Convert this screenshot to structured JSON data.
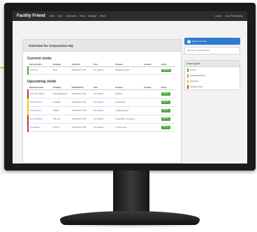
{
  "app": {
    "brand": "Facility Friend",
    "nav_items": [
      "Visits",
      "Tools",
      "Companies",
      "Hosts",
      "Manager",
      "Reset"
    ],
    "nav_right": [
      "Logout",
      "Anne.Francis@hq"
    ]
  },
  "page": {
    "title": "Overview for Corporation HQ"
  },
  "current_visits": {
    "heading": "Current visits",
    "columns": [
      "Current visitor",
      "Company",
      "Arrived at",
      "Host",
      "Purpose",
      "Location",
      "Action"
    ],
    "rows": [
      {
        "visitor": "John Doe",
        "company": "Acme",
        "arrived": "2012-06-19 17:38",
        "host": "Tom Watson",
        "purpose": "Marketing review",
        "location": "",
        "action": "Sign out",
        "status_color": "#4caa3f"
      }
    ]
  },
  "upcoming_visits": {
    "heading": "Upcoming visits",
    "columns": [
      "Expected visitor",
      "Company",
      "Scheduled for",
      "Host",
      "Purpose",
      "Location",
      "Action"
    ],
    "rows": [
      {
        "visitor": "Peter Mc Cabbles",
        "company": "Tree Management",
        "scheduled": "2012-06-19 17:58",
        "host": "Tom Watson",
        "purpose": "Meeting",
        "location": "",
        "action": "Sign in",
        "status_color": "#d6322a"
      },
      {
        "visitor": "Richard Turner",
        "company": "GOLDEN",
        "scheduled": "2012-06-19 17:58",
        "host": "Tom Watson",
        "purpose": "Presentation",
        "location": "",
        "action": "Sign in",
        "status_color": "#f0c419"
      },
      {
        "visitor": "Linnea Martin",
        "company": "SVEEC",
        "scheduled": "2012-06-19 17:58",
        "host": "Tom Watson",
        "purpose": "Logistics project",
        "location": "",
        "action": "Sign in",
        "status_color": "#f0c419"
      },
      {
        "visitor": "Tim Van Ruben",
        "company": "ATAL Ltd",
        "scheduled": "2012-06-19 17:58",
        "host": "Tom Watson",
        "purpose": "Presentation of services",
        "location": "",
        "action": "Sign in",
        "status_color": "#d6322a"
      },
      {
        "visitor": "Tom Massie",
        "company": "PLAN IT",
        "scheduled": "2012-06-19 17:58",
        "host": "Tom Watson",
        "purpose": "IT service test",
        "location": "",
        "action": "Sign in",
        "status_color": "#d6322a"
      }
    ]
  },
  "sidebar": {
    "new_visit_label": "Add a new visit",
    "new_visit_icon": "plus-circle-icon",
    "note": "Add visit by scanning visitor",
    "legend": {
      "title": "Color legend",
      "items": [
        {
          "label": "Current",
          "color": "#4caa3f"
        },
        {
          "label": "Overdue departure",
          "color": "#f08a24"
        },
        {
          "label": "Upcoming",
          "color": "#f0c419"
        },
        {
          "label": "Overdue arrival",
          "color": "#d6322a"
        }
      ]
    }
  }
}
